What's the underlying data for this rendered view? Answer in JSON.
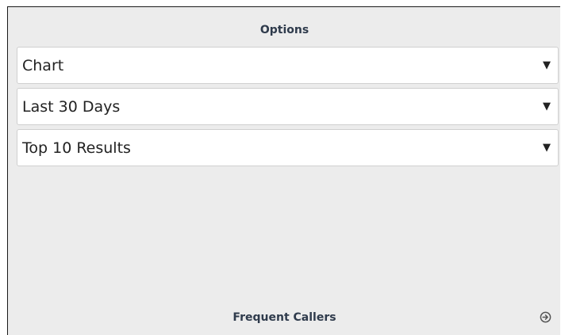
{
  "options_panel": {
    "title": "Options",
    "selects": [
      {
        "value": "Chart",
        "icon": "caret-down-icon"
      },
      {
        "value": "Last 30 Days",
        "icon": "caret-down-icon"
      },
      {
        "value": "Top 10 Results",
        "icon": "caret-down-icon"
      }
    ]
  },
  "footer": {
    "title": "Frequent Callers",
    "icon": "circle-arrow-right-icon"
  },
  "colors": {
    "panel_background": "#ececec",
    "heading_text": "#2f3b4c",
    "select_background": "#ffffff"
  }
}
